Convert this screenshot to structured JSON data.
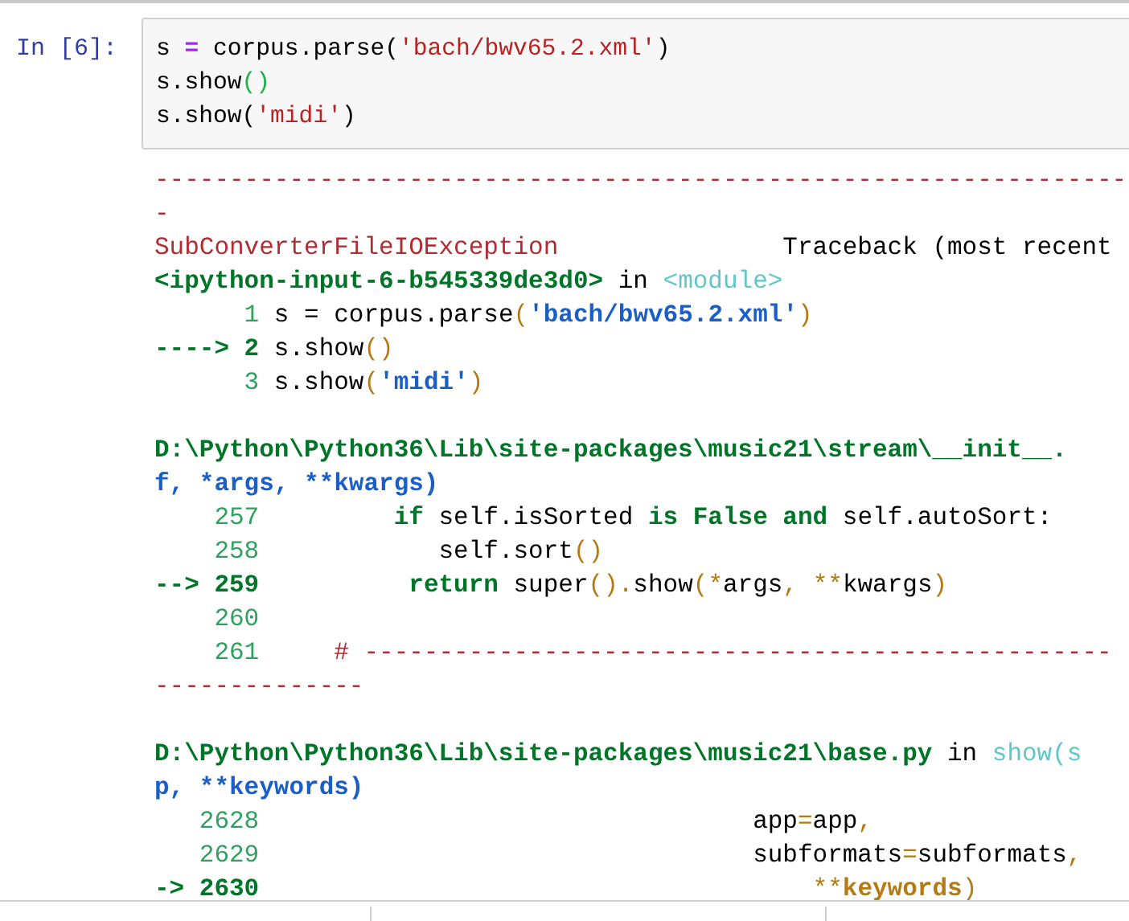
{
  "cell": {
    "prompt": "In [6]:",
    "code_lines": [
      [
        {
          "kind": "plain",
          "text": "s "
        },
        {
          "kind": "op",
          "text": "="
        },
        {
          "kind": "plain",
          "text": " corpus.parse("
        },
        {
          "kind": "str",
          "text": "'bach/bwv65.2.xml'"
        },
        {
          "kind": "plain",
          "text": ")"
        }
      ],
      [
        {
          "kind": "plain",
          "text": "s.show"
        },
        {
          "kind": "match",
          "text": "()"
        }
      ],
      [
        {
          "kind": "plain",
          "text": "s.show("
        },
        {
          "kind": "str",
          "text": "'midi'"
        },
        {
          "kind": "plain",
          "text": ")"
        }
      ]
    ]
  },
  "traceback": {
    "frames": [
      [
        [
          {
            "kind": "red",
            "text": "-----------------------------------------------------------------"
          }
        ],
        [
          {
            "kind": "red",
            "text": "-"
          }
        ],
        [
          {
            "kind": "red",
            "text": "SubConverterFileIOException"
          },
          {
            "kind": "text",
            "text": "               Traceback (most recent"
          }
        ],
        [
          {
            "kind": "path",
            "text": "<ipython-input-6-b545339de3d0>"
          },
          {
            "kind": "text",
            "text": " in "
          },
          {
            "kind": "func",
            "text": "<module>"
          }
        ],
        [
          {
            "kind": "lineno",
            "text": "      1"
          },
          {
            "kind": "text",
            "text": " s = corpus.parse"
          },
          {
            "kind": "punct",
            "text": "("
          },
          {
            "kind": "tstr",
            "text": "'bach/bwv65.2.xml'"
          },
          {
            "kind": "punct",
            "text": ")"
          }
        ],
        [
          {
            "kind": "arrow",
            "text": "----> 2"
          },
          {
            "kind": "text",
            "text": " s.show"
          },
          {
            "kind": "punct",
            "text": "()"
          }
        ],
        [
          {
            "kind": "lineno",
            "text": "      3"
          },
          {
            "kind": "text",
            "text": " s.show"
          },
          {
            "kind": "punct",
            "text": "("
          },
          {
            "kind": "tstr",
            "text": "'midi'"
          },
          {
            "kind": "punct",
            "text": ")"
          }
        ]
      ],
      [
        [
          {
            "kind": "path",
            "text": "D:\\Python\\Python36\\Lib\\site-packages\\music21\\stream\\__init__."
          }
        ],
        [
          {
            "kind": "args",
            "text": "f, *args, **kwargs)"
          }
        ],
        [
          {
            "kind": "lineno",
            "text": "    257         "
          },
          {
            "kind": "kw",
            "text": "if"
          },
          {
            "kind": "text",
            "text": " self.isSorted "
          },
          {
            "kind": "kw",
            "text": "is False and"
          },
          {
            "kind": "text",
            "text": " self.autoSort:"
          }
        ],
        [
          {
            "kind": "lineno",
            "text": "    258"
          },
          {
            "kind": "text",
            "text": "            self.sort"
          },
          {
            "kind": "punct",
            "text": "()"
          }
        ],
        [
          {
            "kind": "arrow",
            "text": "--> 259          "
          },
          {
            "kind": "kw",
            "text": "return"
          },
          {
            "kind": "text",
            "text": " super"
          },
          {
            "kind": "punct",
            "text": "()."
          },
          {
            "kind": "text",
            "text": "show"
          },
          {
            "kind": "punct",
            "text": "(*"
          },
          {
            "kind": "text",
            "text": "args"
          },
          {
            "kind": "punct",
            "text": ", **"
          },
          {
            "kind": "text",
            "text": "kwargs"
          },
          {
            "kind": "punct",
            "text": ")"
          }
        ],
        [
          {
            "kind": "lineno",
            "text": "    260"
          }
        ],
        [
          {
            "kind": "lineno",
            "text": "    261     "
          },
          {
            "kind": "red",
            "text": "# --------------------------------------------------"
          }
        ],
        [
          {
            "kind": "red",
            "text": "--------------"
          }
        ]
      ],
      [
        [
          {
            "kind": "path",
            "text": "D:\\Python\\Python36\\Lib\\site-packages\\music21\\base.py"
          },
          {
            "kind": "text",
            "text": " in "
          },
          {
            "kind": "func",
            "text": "show(s"
          }
        ],
        [
          {
            "kind": "args",
            "text": "p, **keywords)"
          }
        ],
        [
          {
            "kind": "lineno",
            "text": "   2628"
          },
          {
            "kind": "text",
            "text": "                                 app"
          },
          {
            "kind": "punct",
            "text": "="
          },
          {
            "kind": "text",
            "text": "app"
          },
          {
            "kind": "punct",
            "text": ","
          }
        ],
        [
          {
            "kind": "lineno",
            "text": "   2629"
          },
          {
            "kind": "text",
            "text": "                                 subformats"
          },
          {
            "kind": "punct",
            "text": "="
          },
          {
            "kind": "text",
            "text": "subformats"
          },
          {
            "kind": "punct",
            "text": ","
          }
        ],
        [
          {
            "kind": "arrow",
            "text": "-> 2630"
          },
          {
            "kind": "punct",
            "text": "                                     **"
          },
          {
            "kind": "kwb",
            "text": "keywords"
          },
          {
            "kind": "punct",
            "text": ")"
          }
        ]
      ]
    ]
  }
}
